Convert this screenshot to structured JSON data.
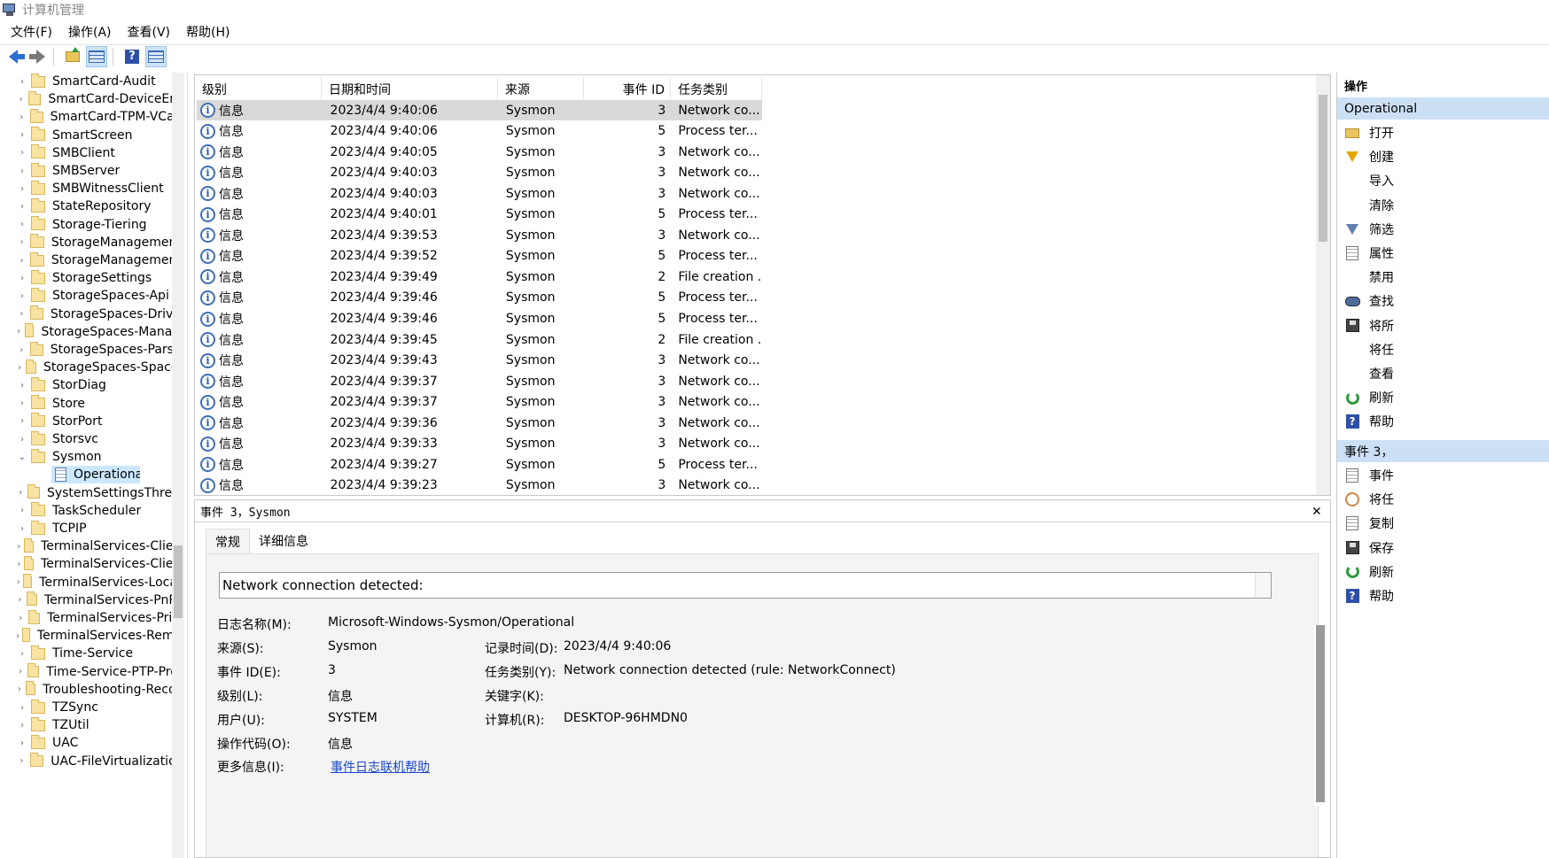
{
  "window": {
    "title": "计算机管理"
  },
  "menu": [
    "文件(F)",
    "操作(A)",
    "查看(V)",
    "帮助(H)"
  ],
  "toolbar": [
    "back-icon",
    "forward-icon",
    "up-folder-icon",
    "show-hide-tree-icon",
    "help-icon",
    "action-pane-icon"
  ],
  "tree": {
    "items": [
      "SmartCard-Audit",
      "SmartCard-DeviceEnum",
      "SmartCard-TPM-VCard",
      "SmartScreen",
      "SMBClient",
      "SMBServer",
      "SMBWitnessClient",
      "StateRepository",
      "Storage-Tiering",
      "StorageManagement",
      "StorageManagement",
      "StorageSettings",
      "StorageSpaces-Api",
      "StorageSpaces-Driver",
      "StorageSpaces-ManagementAgent",
      "StorageSpaces-Parser",
      "StorageSpaces-SpaceManager",
      "StorDiag",
      "Store",
      "StorPort",
      "Storsvc",
      "Sysmon"
    ],
    "selected_child": "Operational",
    "items_after": [
      "SystemSettingsThreshold",
      "TaskScheduler",
      "TCPIP",
      "TerminalServices-ClientActiveXCore",
      "TerminalServices-ClientUSBDevices",
      "TerminalServices-LocalSessionManager",
      "TerminalServices-PnPDevices",
      "TerminalServices-Printers",
      "TerminalServices-RemoteConnectionManager",
      "Time-Service",
      "Time-Service-PTP-Provider",
      "Troubleshooting-Recommended",
      "TZSync",
      "TZUtil",
      "UAC",
      "UAC-FileVirtualization"
    ]
  },
  "events": {
    "columns": [
      "级别",
      "日期和时间",
      "来源",
      "事件 ID",
      "任务类别"
    ],
    "rows": [
      [
        "信息",
        "2023/4/4 9:40:06",
        "Sysmon",
        "3",
        "Network co..."
      ],
      [
        "信息",
        "2023/4/4 9:40:06",
        "Sysmon",
        "5",
        "Process ter..."
      ],
      [
        "信息",
        "2023/4/4 9:40:05",
        "Sysmon",
        "3",
        "Network co..."
      ],
      [
        "信息",
        "2023/4/4 9:40:03",
        "Sysmon",
        "3",
        "Network co..."
      ],
      [
        "信息",
        "2023/4/4 9:40:03",
        "Sysmon",
        "3",
        "Network co..."
      ],
      [
        "信息",
        "2023/4/4 9:40:01",
        "Sysmon",
        "5",
        "Process ter..."
      ],
      [
        "信息",
        "2023/4/4 9:39:53",
        "Sysmon",
        "3",
        "Network co..."
      ],
      [
        "信息",
        "2023/4/4 9:39:52",
        "Sysmon",
        "5",
        "Process ter..."
      ],
      [
        "信息",
        "2023/4/4 9:39:49",
        "Sysmon",
        "2",
        "File creation ..."
      ],
      [
        "信息",
        "2023/4/4 9:39:46",
        "Sysmon",
        "5",
        "Process ter..."
      ],
      [
        "信息",
        "2023/4/4 9:39:46",
        "Sysmon",
        "5",
        "Process ter..."
      ],
      [
        "信息",
        "2023/4/4 9:39:45",
        "Sysmon",
        "2",
        "File creation ..."
      ],
      [
        "信息",
        "2023/4/4 9:39:43",
        "Sysmon",
        "3",
        "Network co..."
      ],
      [
        "信息",
        "2023/4/4 9:39:37",
        "Sysmon",
        "3",
        "Network co..."
      ],
      [
        "信息",
        "2023/4/4 9:39:37",
        "Sysmon",
        "3",
        "Network co..."
      ],
      [
        "信息",
        "2023/4/4 9:39:36",
        "Sysmon",
        "3",
        "Network co..."
      ],
      [
        "信息",
        "2023/4/4 9:39:33",
        "Sysmon",
        "3",
        "Network co..."
      ],
      [
        "信息",
        "2023/4/4 9:39:27",
        "Sysmon",
        "5",
        "Process ter..."
      ],
      [
        "信息",
        "2023/4/4 9:39:23",
        "Sysmon",
        "3",
        "Network co..."
      ]
    ],
    "selected_index": 0
  },
  "detail": {
    "header": "事件 3，Sysmon",
    "tabs": [
      "常规",
      "详细信息"
    ],
    "description": "Network connection detected:",
    "log_name_label": "日志名称(M):",
    "log_name": "Microsoft-Windows-Sysmon/Operational",
    "source_label": "来源(S):",
    "source": "Sysmon",
    "logged_label": "记录时间(D):",
    "logged": "2023/4/4 9:40:06",
    "event_id_label": "事件 ID(E):",
    "event_id": "3",
    "task_label": "任务类别(Y):",
    "task": "Network connection detected (rule: NetworkConnect)",
    "level_label": "级别(L):",
    "level": "信息",
    "keywords_label": "关键字(K):",
    "user_label": "用户(U):",
    "user": "SYSTEM",
    "computer_label": "计算机(R):",
    "computer": "DESKTOP-96HMDN0",
    "opcode_label": "操作代码(O):",
    "opcode": "信息",
    "more_info_label": "更多信息(I):",
    "more_info_link": "事件日志联机帮助"
  },
  "actions": {
    "title": "操作",
    "section1": "Operational",
    "section1_items": [
      {
        "icon": "open-folder-icon",
        "label": "打开"
      },
      {
        "icon": "create-filter-icon",
        "label": "创建"
      },
      {
        "icon": "",
        "label": "导入"
      },
      {
        "icon": "",
        "label": "清除"
      },
      {
        "icon": "filter-icon",
        "label": "筛选"
      },
      {
        "icon": "properties-icon",
        "label": "属性"
      },
      {
        "icon": "",
        "label": "禁用"
      },
      {
        "icon": "find-icon",
        "label": "查找"
      },
      {
        "icon": "save-icon",
        "label": "将所"
      },
      {
        "icon": "",
        "label": "将任"
      },
      {
        "icon": "",
        "label": "查看"
      },
      {
        "icon": "refresh-icon",
        "label": "刷新"
      },
      {
        "icon": "help-icon",
        "label": "帮助"
      }
    ],
    "section2": "事件 3，",
    "section2_items": [
      {
        "icon": "event-properties-icon",
        "label": "事件"
      },
      {
        "icon": "attach-task-icon",
        "label": "将任"
      },
      {
        "icon": "copy-icon",
        "label": "复制"
      },
      {
        "icon": "save-icon",
        "label": "保存"
      },
      {
        "icon": "refresh-icon",
        "label": "刷新"
      },
      {
        "icon": "help-icon",
        "label": "帮助"
      }
    ]
  },
  "colors": {
    "selected_row": "#d9d9d9",
    "tree_selected": "#cce8ff",
    "actions_section": "#cce0f5",
    "link": "#1a47c9"
  }
}
